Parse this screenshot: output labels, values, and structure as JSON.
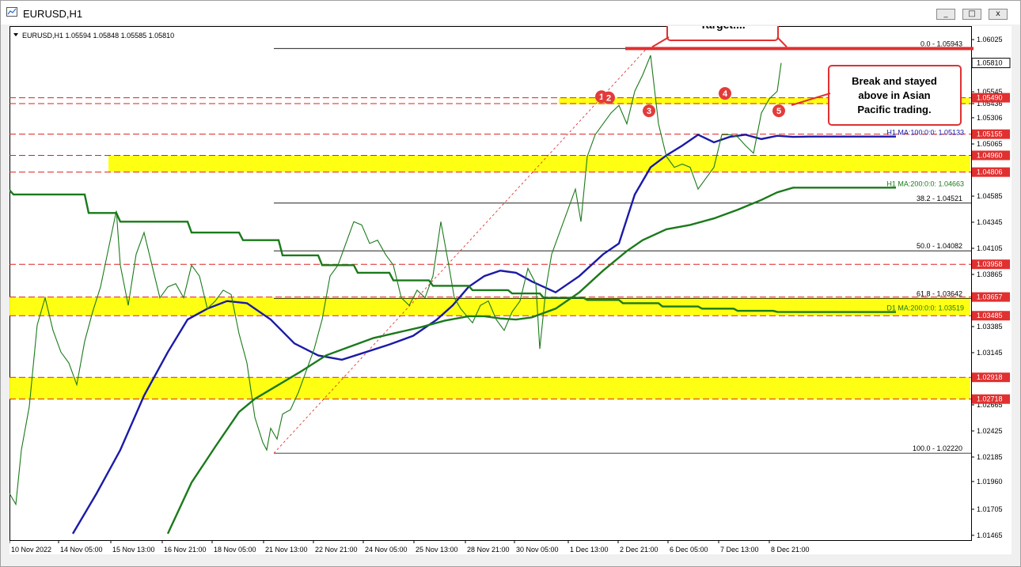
{
  "window": {
    "title": "EURUSD,H1",
    "buttons": [
      "_",
      "□",
      "x"
    ]
  },
  "chart_data": {
    "type": "line",
    "symbol_info": "EURUSD,H1  1.05594 1.05848 1.05585 1.05810",
    "ylim": [
      1.0145,
      1.0612
    ],
    "y_ticks": [
      "1.06025",
      "1.05810",
      "1.05545",
      "1.05436",
      "1.05306",
      "1.05155",
      "1.05065",
      "1.04960",
      "1.04806",
      "1.04585",
      "1.04345",
      "1.04105",
      "1.03958",
      "1.03865",
      "1.03657",
      "1.03485",
      "1.03385",
      "1.03145",
      "1.02918",
      "1.02718",
      "1.02665",
      "1.02425",
      "1.02185",
      "1.01960",
      "1.01705",
      "1.01465"
    ],
    "x_ticks": [
      "10 Nov 2022",
      "14 Nov 05:00",
      "15 Nov 13:00",
      "16 Nov 21:00",
      "18 Nov 05:00",
      "21 Nov 13:00",
      "22 Nov 21:00",
      "24 Nov 05:00",
      "25 Nov 13:00",
      "28 Nov 21:00",
      "30 Nov 05:00",
      "1 Dec 13:00",
      "2 Dec 21:00",
      "6 Dec 05:00",
      "7 Dec 13:00",
      "8 Dec 21:00"
    ],
    "current_price": 1.0581,
    "horizontal_levels": [
      {
        "value": 1.0549,
        "label": "1.05490",
        "color": "#dd2222"
      },
      {
        "value": 1.05436,
        "label": "",
        "color": "#dd2222"
      },
      {
        "value": 1.05155,
        "label": "1.05155",
        "color": "#dd2222"
      },
      {
        "value": 1.0496,
        "label": "1.04960",
        "color": "#dd2222"
      },
      {
        "value": 1.04806,
        "label": "1.04806",
        "color": "#dd2222"
      },
      {
        "value": 1.03958,
        "label": "1.03958",
        "color": "#dd2222"
      },
      {
        "value": 1.03657,
        "label": "1.03657",
        "color": "#dd2222"
      },
      {
        "value": 1.03485,
        "label": "1.03485",
        "color": "#dd2222"
      },
      {
        "value": 1.02918,
        "label": "1.02918",
        "color": "#dd2222"
      },
      {
        "value": 1.02718,
        "label": "1.02718",
        "color": "#dd2222"
      }
    ],
    "yellow_zones": [
      {
        "from": 1.0543,
        "to": 1.0549,
        "start": "1 Dec 13:00"
      },
      {
        "from": 1.04806,
        "to": 1.0496,
        "start": "15 Nov 13:00"
      },
      {
        "from": 1.03485,
        "to": 1.03657,
        "start": "10 Nov 2022"
      },
      {
        "from": 1.02718,
        "to": 1.02918,
        "start": "10 Nov 2022"
      }
    ],
    "fibonacci": [
      {
        "label": "0.0 - 1.05943",
        "value": 1.05943
      },
      {
        "label": "38.2 - 1.04521",
        "value": 1.04521
      },
      {
        "label": "50.0 - 1.04082",
        "value": 1.04082
      },
      {
        "label": "61.8 - 1.03642",
        "value": 1.03642
      },
      {
        "label": "100.0 - 1.02220",
        "value": 1.0222
      }
    ],
    "ma_labels": [
      {
        "text": "H1 MA:100:0:0: 1.05133",
        "value": 1.05133,
        "color": "#1a1aa8"
      },
      {
        "text": "H1 MA:200:0:0: 1.04663",
        "value": 1.04663,
        "color": "#1a7a1a"
      },
      {
        "text": "D1 MA:200:0:0: 1.03519",
        "value": 1.03519,
        "color": "#1a7a1a"
      }
    ],
    "series": [
      {
        "name": "H1 MA:100",
        "color": "#1a1aa8",
        "x": [
          80,
          110,
          140,
          170,
          200,
          225,
          250,
          275,
          300,
          330,
          360,
          390,
          420,
          450,
          480,
          510,
          540,
          560,
          580,
          600,
          620,
          640,
          660,
          690,
          720,
          750,
          770,
          790,
          810,
          830,
          850,
          870,
          890,
          910,
          930,
          950,
          970,
          990,
          1010,
          1100,
          1120
        ],
        "y": [
          1.0148,
          1.0185,
          1.0225,
          1.0275,
          1.0315,
          1.0345,
          1.0355,
          1.0362,
          1.036,
          1.0345,
          1.0323,
          1.0312,
          1.0308,
          1.0315,
          1.0322,
          1.033,
          1.0345,
          1.0358,
          1.0375,
          1.0385,
          1.039,
          1.0388,
          1.038,
          1.037,
          1.0385,
          1.0405,
          1.0415,
          1.046,
          1.0485,
          1.0496,
          1.0505,
          1.0515,
          1.0508,
          1.0513,
          1.0515,
          1.0511,
          1.0514,
          1.0513,
          1.05133,
          1.05133,
          1.05133
        ]
      },
      {
        "name": "H1 MA:200",
        "color": "#1a7a1a",
        "x": [
          200,
          230,
          260,
          290,
          310,
          340,
          370,
          400,
          430,
          460,
          490,
          520,
          550,
          580,
          600,
          620,
          640,
          660,
          690,
          720,
          750,
          780,
          800,
          830,
          860,
          890,
          920,
          950,
          970,
          990,
          1010,
          1100,
          1120
        ],
        "y": [
          1.0148,
          1.0195,
          1.0228,
          1.026,
          1.0272,
          1.0285,
          1.0298,
          1.0312,
          1.032,
          1.0328,
          1.0333,
          1.0338,
          1.0344,
          1.0348,
          1.0348,
          1.0346,
          1.0345,
          1.0347,
          1.0355,
          1.037,
          1.039,
          1.0408,
          1.0418,
          1.0428,
          1.0432,
          1.0438,
          1.0446,
          1.0455,
          1.0462,
          1.04663,
          1.04663,
          1.04663,
          1.04663
        ]
      },
      {
        "name": "D1 MA:200",
        "color": "#1a7a1a",
        "x": [
          0,
          5,
          95,
          100,
          135,
          140,
          225,
          230,
          290,
          295,
          340,
          345,
          390,
          395,
          435,
          440,
          480,
          485,
          530,
          535,
          580,
          585,
          630,
          635,
          670,
          675,
          725,
          730,
          770,
          775,
          820,
          825,
          870,
          875,
          915,
          920,
          965,
          970,
          1010,
          1120
        ],
        "y": [
          1.0464,
          1.046,
          1.046,
          1.0443,
          1.0443,
          1.0435,
          1.0435,
          1.0425,
          1.0425,
          1.0418,
          1.0418,
          1.0404,
          1.0404,
          1.0395,
          1.0395,
          1.0388,
          1.0388,
          1.0381,
          1.0381,
          1.0376,
          1.0376,
          1.0372,
          1.0372,
          1.0369,
          1.0369,
          1.0365,
          1.0365,
          1.0363,
          1.0363,
          1.036,
          1.036,
          1.0357,
          1.0357,
          1.0355,
          1.0355,
          1.0353,
          1.0353,
          1.0352,
          1.03519,
          1.03519
        ]
      },
      {
        "name": "EURUSD",
        "color": "#1a7a1a",
        "x": [
          0,
          8,
          15,
          25,
          35,
          45,
          55,
          65,
          75,
          85,
          95,
          105,
          115,
          125,
          135,
          140,
          150,
          160,
          170,
          180,
          190,
          200,
          210,
          220,
          230,
          240,
          250,
          260,
          270,
          280,
          290,
          300,
          310,
          320,
          325,
          330,
          338,
          345,
          355,
          365,
          375,
          385,
          395,
          405,
          415,
          425,
          435,
          445,
          455,
          465,
          475,
          485,
          495,
          505,
          515,
          525,
          535,
          545,
          555,
          562,
          570,
          578,
          585,
          595,
          605,
          615,
          625,
          635,
          645,
          655,
          665,
          670,
          678,
          685,
          695,
          705,
          715,
          722,
          730,
          740,
          750,
          760,
          770,
          780,
          790,
          800,
          810,
          820,
          830,
          840,
          850,
          860,
          870,
          880,
          890,
          900,
          910,
          920,
          930,
          940,
          950,
          960,
          970,
          975
        ],
        "y": [
          1.0185,
          1.0175,
          1.0225,
          1.0265,
          1.034,
          1.0365,
          1.0335,
          1.0315,
          1.0305,
          1.0285,
          1.0325,
          1.0352,
          1.0375,
          1.041,
          1.0445,
          1.0395,
          1.0358,
          1.0405,
          1.0425,
          1.0395,
          1.0365,
          1.0375,
          1.0378,
          1.0365,
          1.0395,
          1.0385,
          1.0355,
          1.0362,
          1.0372,
          1.0368,
          1.0332,
          1.0305,
          1.0255,
          1.0232,
          1.0225,
          1.0245,
          1.0235,
          1.0258,
          1.0262,
          1.0278,
          1.0298,
          1.0318,
          1.0345,
          1.0385,
          1.0395,
          1.0415,
          1.0435,
          1.0432,
          1.0415,
          1.0418,
          1.0405,
          1.0395,
          1.0365,
          1.0358,
          1.0372,
          1.0365,
          1.0385,
          1.0435,
          1.0395,
          1.0365,
          1.0355,
          1.0348,
          1.0342,
          1.0358,
          1.0362,
          1.0345,
          1.0335,
          1.0352,
          1.0362,
          1.0392,
          1.0378,
          1.0318,
          1.0375,
          1.0405,
          1.0425,
          1.0445,
          1.0465,
          1.0435,
          1.0495,
          1.0515,
          1.0525,
          1.0535,
          1.0542,
          1.0525,
          1.0555,
          1.057,
          1.0588,
          1.0525,
          1.0495,
          1.0485,
          1.0488,
          1.0485,
          1.0465,
          1.0475,
          1.0485,
          1.0515,
          1.0515,
          1.0513,
          1.0505,
          1.0498,
          1.0535,
          1.0548,
          1.0555,
          1.0581
        ]
      }
    ],
    "annotations": {
      "target_box": "Target....",
      "break_box": "Break and stayed above in Asian Pacific trading.",
      "markers": [
        "1",
        "2",
        "3",
        "4",
        "5"
      ]
    }
  }
}
